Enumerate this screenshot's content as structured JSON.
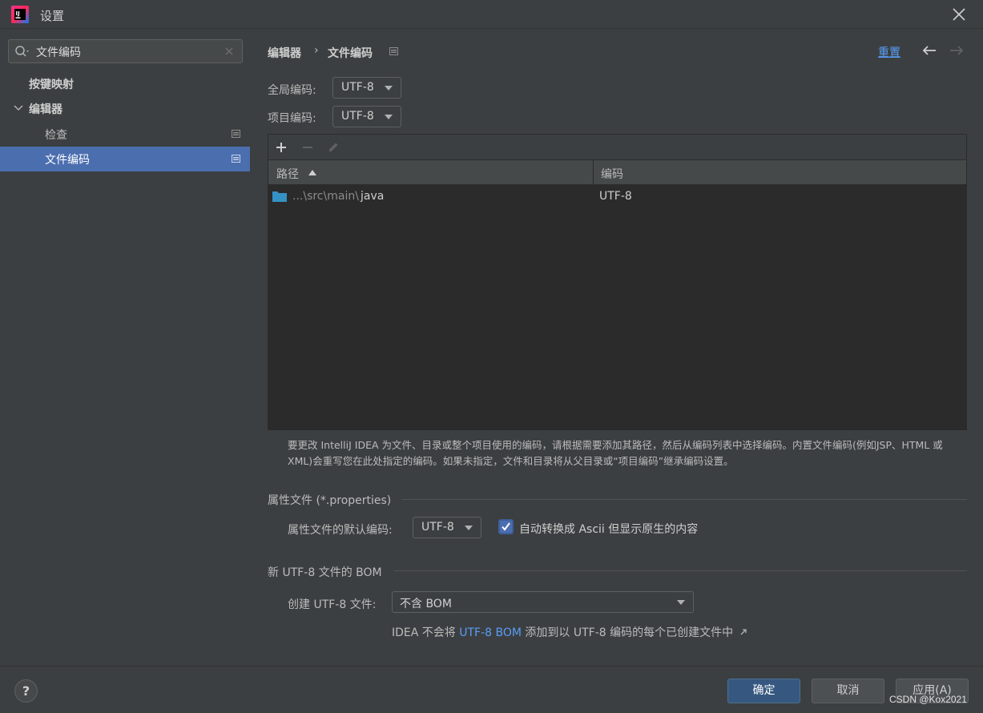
{
  "window": {
    "title": "设置"
  },
  "search": {
    "value": "文件编码"
  },
  "sidebar": {
    "items": [
      {
        "label": "按键映射"
      },
      {
        "label": "编辑器"
      },
      {
        "label": "检查"
      },
      {
        "label": "文件编码"
      }
    ]
  },
  "breadcrumb": {
    "parent": "编辑器",
    "separator": "›",
    "current": "文件编码"
  },
  "header": {
    "reset_label": "重置"
  },
  "encodings": {
    "global_label": "全局编码:",
    "global_value": "UTF-8",
    "project_label": "项目编码:",
    "project_value": "UTF-8"
  },
  "table": {
    "columns": [
      "路径",
      "编码"
    ],
    "rows": [
      {
        "path_prefix": "...\\src\\main\\",
        "path_last": "java",
        "encoding": "UTF-8"
      }
    ]
  },
  "description": "要更改 IntelliJ IDEA 为文件、目录或整个项目使用的编码，请根据需要添加其路径，然后从编码列表中选择编码。内置文件编码(例如JSP、HTML 或 XML)会重写您在此处指定的编码。如果未指定，文件和目录将从父目录或“项目编码”继承编码设置。",
  "properties_section": {
    "title": "属性文件 (*.properties)",
    "default_label": "属性文件的默认编码:",
    "default_value": "UTF-8",
    "checkbox_label": "自动转换成 Ascii 但显示原生的内容",
    "checkbox_checked": true
  },
  "bom_section": {
    "title": "新 UTF-8 文件的 BOM",
    "create_label": "创建 UTF-8 文件:",
    "create_value": "不含 BOM",
    "info_prefix": "IDEA 不会将 ",
    "info_link": "UTF-8 BOM",
    "info_suffix": " 添加到以 UTF-8 编码的每个已创建文件中"
  },
  "footer": {
    "help_label": "?",
    "ok_label": "确定",
    "cancel_label": "取消",
    "apply_label": "应用(A)",
    "watermark": "CSDN @Kox2021"
  },
  "colors": {
    "background": "#3c3f41",
    "selection": "#4b6eaf",
    "link": "#589df6",
    "table_bg": "#2b2b2b",
    "folder": "#3592c4"
  },
  "icons": [
    "intellij-logo-icon",
    "close-icon",
    "search-icon",
    "clear-icon",
    "chevron-down-icon",
    "project-scope-icon",
    "arrow-left-icon",
    "arrow-right-icon",
    "add-icon",
    "remove-icon",
    "edit-icon",
    "sort-asc-icon",
    "folder-icon",
    "dropdown-arrow-icon",
    "checkmark-icon",
    "external-link-icon"
  ]
}
